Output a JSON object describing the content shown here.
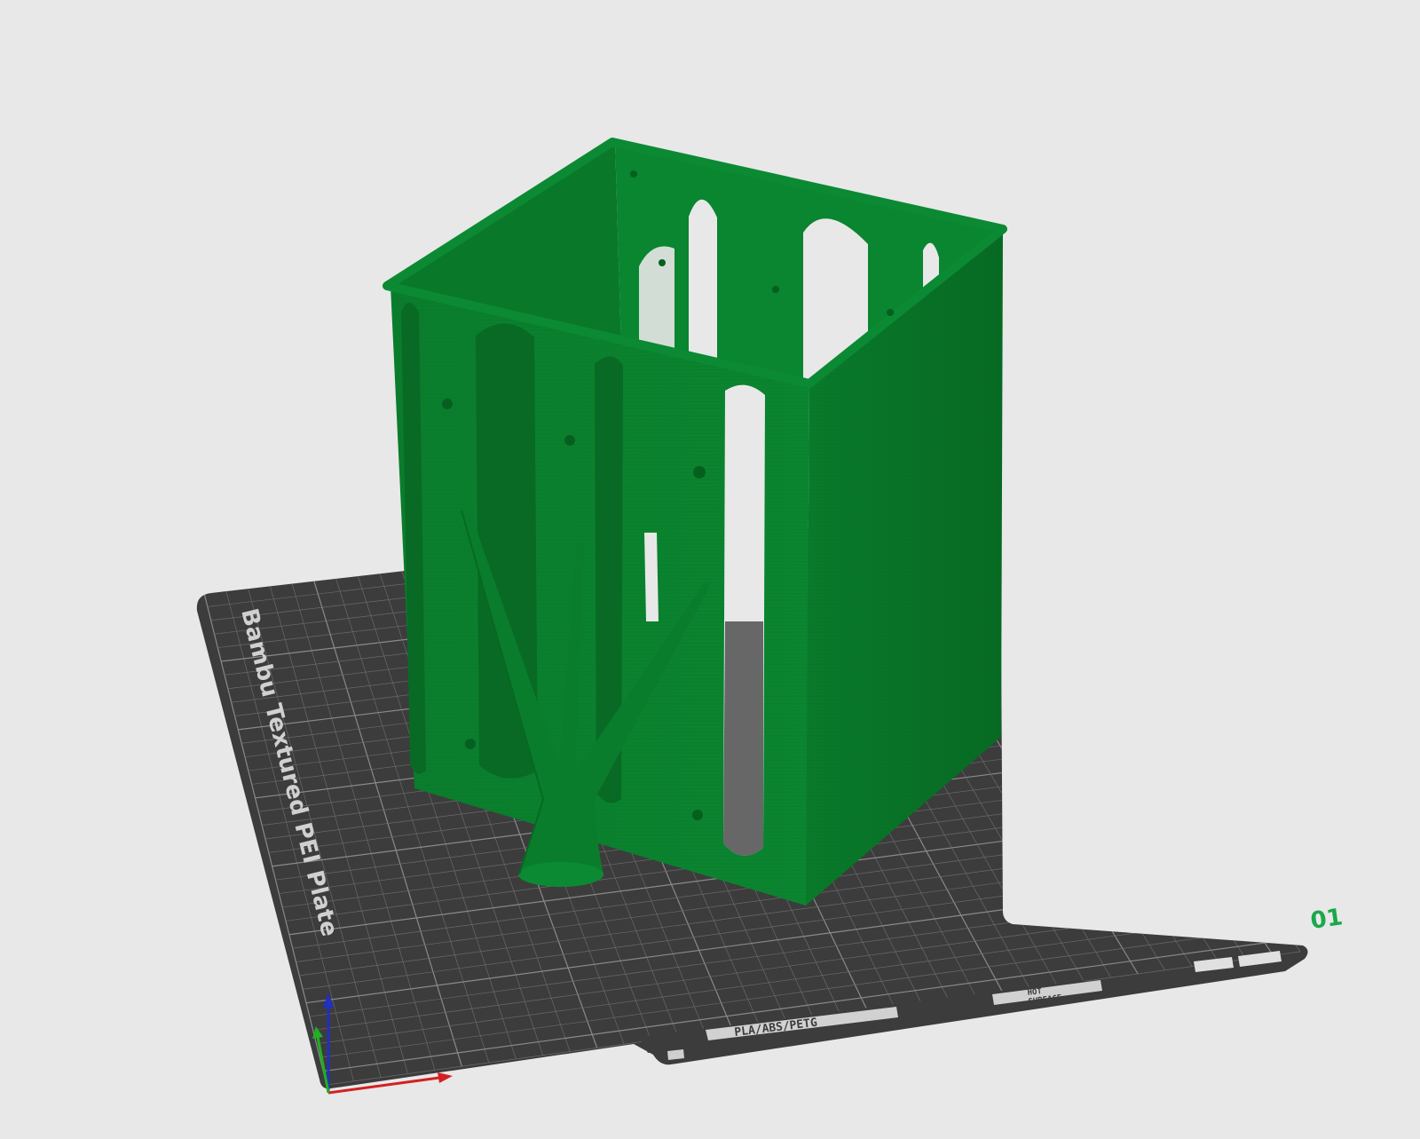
{
  "plate": {
    "name": "Bambu Textured PEI Plate",
    "number": "01",
    "filament_label": "PLA/ABS/PETG",
    "warning_line1": "HOT",
    "warning_line2": "SURFACE"
  },
  "model": {
    "color": "#0b7a2c"
  },
  "colors": {
    "background": "#e8e8e8",
    "bed": "#3c3c3c",
    "grid": "#6a6a6a",
    "plate_number": "#1aa84a",
    "axis_x": "#d42020",
    "axis_y": "#20b020",
    "axis_z": "#2030c0"
  }
}
